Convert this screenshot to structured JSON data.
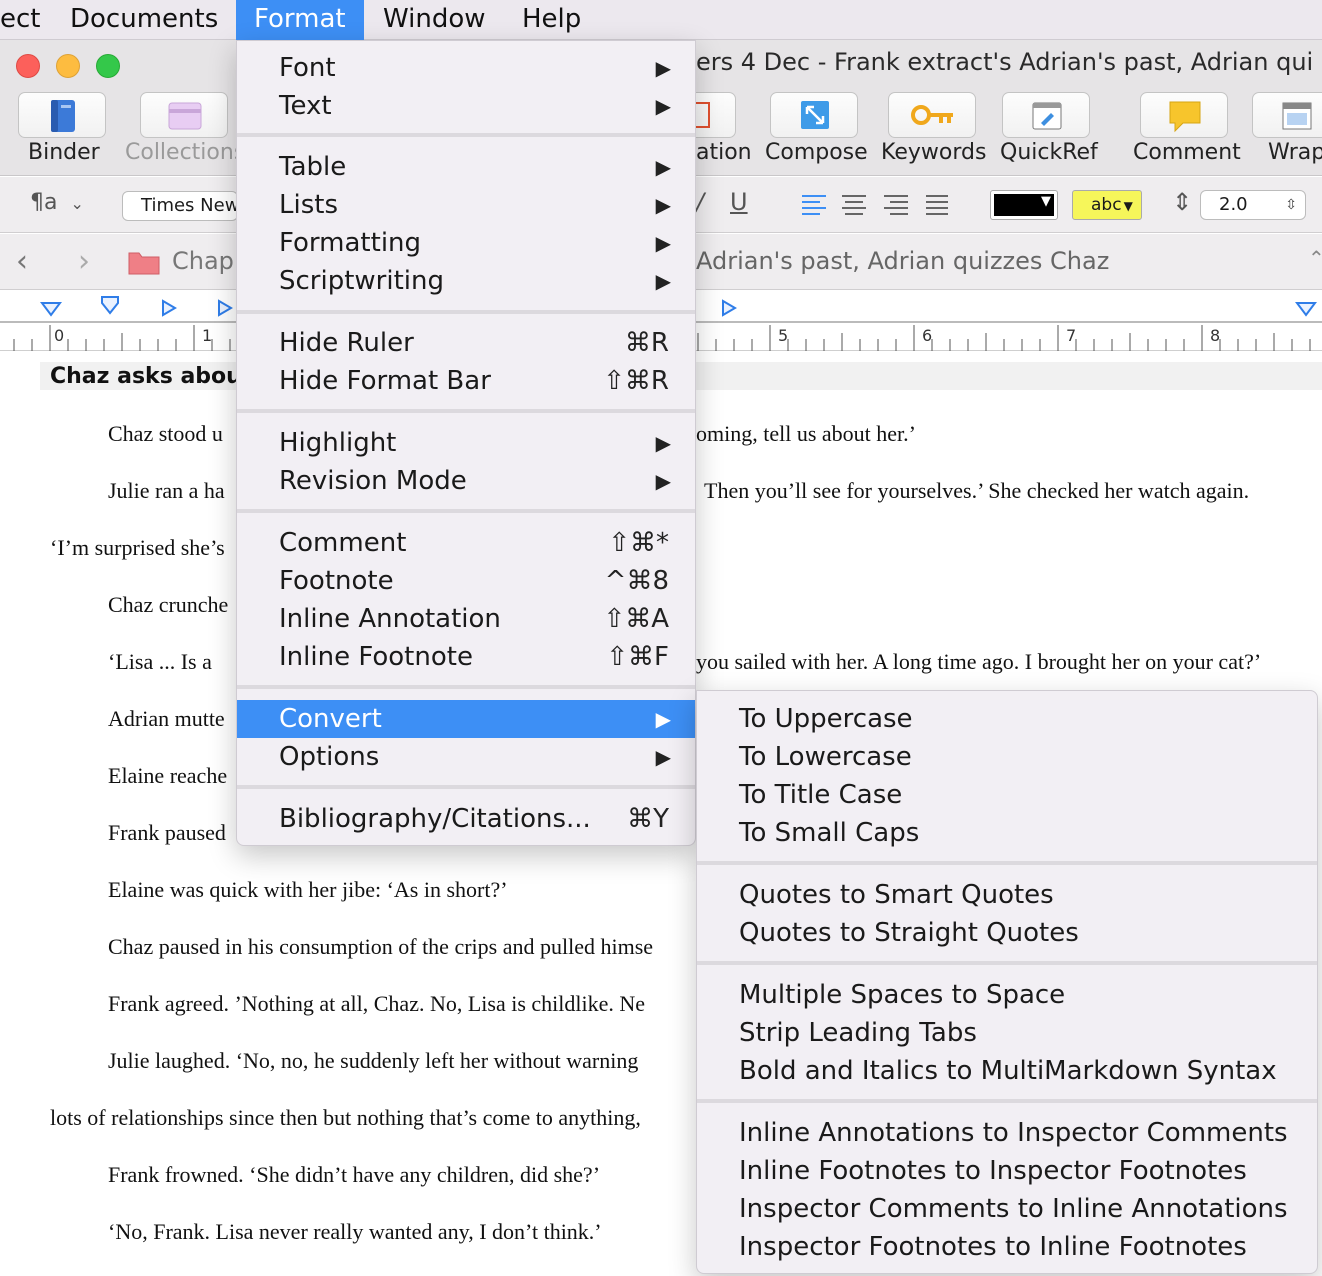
{
  "menubar": {
    "items": [
      "ect",
      "Documents",
      "Format",
      "Window",
      "Help"
    ]
  },
  "window": {
    "title": "ers   4 Dec - Frank extract's Adrian's past, Adrian qui"
  },
  "toolbar": {
    "binder": "Binder",
    "collections": "Collections",
    "compose_partial": "ation",
    "compose": "Compose",
    "keywords": "Keywords",
    "quickref": "QuickRef",
    "comment": "Comment",
    "wrap": "Wrap"
  },
  "formatbar": {
    "styles": "¶a",
    "font": "Times New",
    "underline": "U",
    "italic_partial": "/",
    "highlight": "abc",
    "line_spacing": "2.0"
  },
  "navbar": {
    "folder": "Chap",
    "doc_title": "Adrian's past, Adrian quizzes Chaz"
  },
  "ruler": {
    "numbers": [
      "0",
      "1",
      "5",
      "6",
      "7",
      "8"
    ]
  },
  "editor": {
    "heading": "Chaz asks about",
    "paragraphs": [
      "Chaz stood u",
      "oming, tell us about her.’",
      "Julie ran a ha",
      "Then you’ll see for yourselves.’ She checked her watch again.",
      "‘I’m surprised she’s",
      "Chaz crunche",
      "‘Lisa  ...  Is a",
      "you sailed with her. A long time ago. I brought her on your cat?’",
      "Adrian mutte",
      "Elaine reache",
      "Frank paused",
      "Elaine was quick with her jibe: ‘As in short?’",
      "Chaz paused in his consumption of the crips and pulled himse",
      "Frank agreed. ’Nothing at all, Chaz. No, Lisa is childlike. Ne",
      "Julie laughed. ‘No, no, he suddenly left her without warning",
      "lots of relationships since then but nothing that’s come to anything,",
      "Frank frowned. ‘She didn’t have any children, did she?’",
      "‘No, Frank. Lisa never really wanted any, I don’t think.’"
    ]
  },
  "format_menu": {
    "groups": [
      [
        {
          "label": "Font",
          "submenu": true
        },
        {
          "label": "Text",
          "submenu": true
        }
      ],
      [
        {
          "label": "Table",
          "submenu": true
        },
        {
          "label": "Lists",
          "submenu": true
        },
        {
          "label": "Formatting",
          "submenu": true
        },
        {
          "label": "Scriptwriting",
          "submenu": true
        }
      ],
      [
        {
          "label": "Hide Ruler",
          "shortcut": "⌘R"
        },
        {
          "label": "Hide Format Bar",
          "shortcut": "⇧⌘R"
        }
      ],
      [
        {
          "label": "Highlight",
          "submenu": true
        },
        {
          "label": "Revision Mode",
          "submenu": true
        }
      ],
      [
        {
          "label": "Comment",
          "shortcut": "⇧⌘*"
        },
        {
          "label": "Footnote",
          "shortcut": "^⌘8"
        },
        {
          "label": "Inline Annotation",
          "shortcut": "⇧⌘A"
        },
        {
          "label": "Inline Footnote",
          "shortcut": "⇧⌘F"
        }
      ],
      [
        {
          "label": "Convert",
          "submenu": true,
          "highlighted": true
        },
        {
          "label": "Options",
          "submenu": true
        }
      ],
      [
        {
          "label": "Bibliography/Citations...",
          "shortcut": "⌘Y"
        }
      ]
    ]
  },
  "convert_menu": {
    "groups": [
      [
        "To Uppercase",
        "To Lowercase",
        "To Title Case",
        "To Small Caps"
      ],
      [
        "Quotes to Smart Quotes",
        "Quotes to Straight Quotes"
      ],
      [
        "Multiple Spaces to Space",
        "Strip Leading Tabs",
        "Bold and Italics to MultiMarkdown Syntax"
      ],
      [
        "Inline Annotations to Inspector Comments",
        "Inline Footnotes to Inspector Footnotes",
        "Inspector Comments to Inline Annotations",
        "Inspector Footnotes to Inline Footnotes"
      ]
    ]
  },
  "colors": {
    "accent": "#3d8ff5",
    "close": "#fc605b",
    "minimize": "#fdbc40",
    "zoom": "#34c84a",
    "highlight_yellow": "#f6f65a"
  }
}
